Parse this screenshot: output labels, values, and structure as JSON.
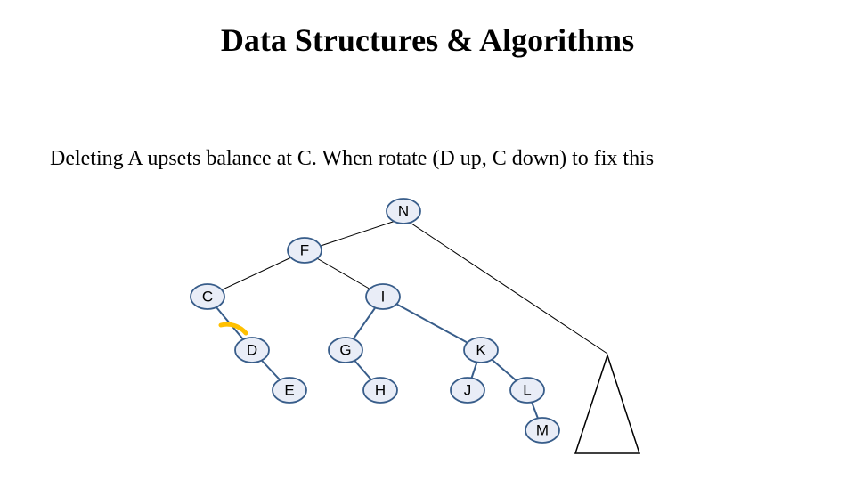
{
  "title": "Data Structures & Algorithms",
  "subtitle": "Deleting A upsets balance at C. When rotate (D up, C down) to fix this",
  "nodes": {
    "N": "N",
    "F": "F",
    "C": "C",
    "I": "I",
    "D": "D",
    "G": "G",
    "K": "K",
    "E": "E",
    "H": "H",
    "J": "J",
    "L": "L",
    "M": "M"
  }
}
